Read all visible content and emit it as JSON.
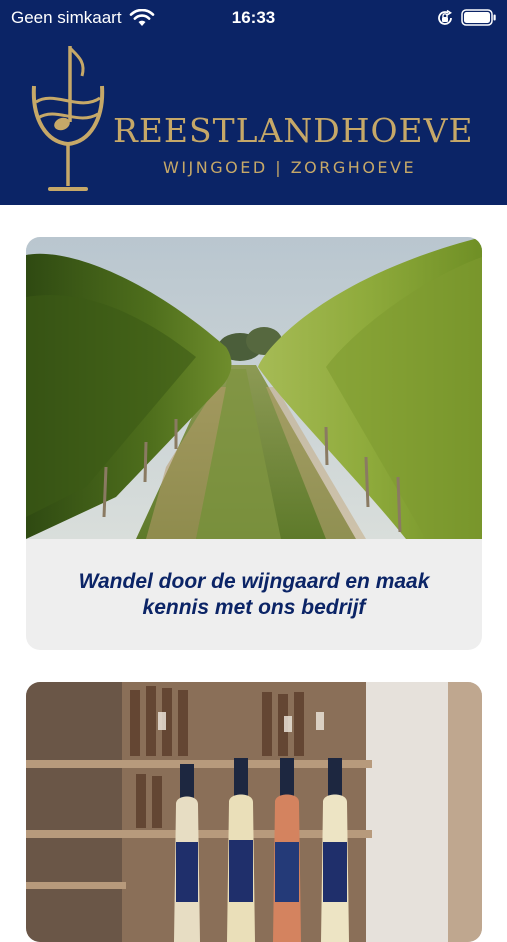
{
  "status_bar": {
    "carrier": "Geen simkaart",
    "time": "16:33",
    "icons": [
      "wifi-icon",
      "rotation-lock-icon",
      "battery-icon"
    ]
  },
  "header": {
    "brand_name": "REESTLANDHOEVE",
    "brand_subtitle": "WIJNGOED | ZORGHOEVE",
    "logo": "wine-glass-music-note-logo"
  },
  "cards": [
    {
      "image": "vineyard-path-photo",
      "caption": "Wandel door de wijngaard en maak kennis met ons bedrijf"
    },
    {
      "image": "wine-bottles-shelf-photo",
      "caption": ""
    }
  ],
  "colors": {
    "brand_navy": "#0b2466",
    "brand_gold": "#c6a868",
    "card_background": "#eeeeee"
  }
}
